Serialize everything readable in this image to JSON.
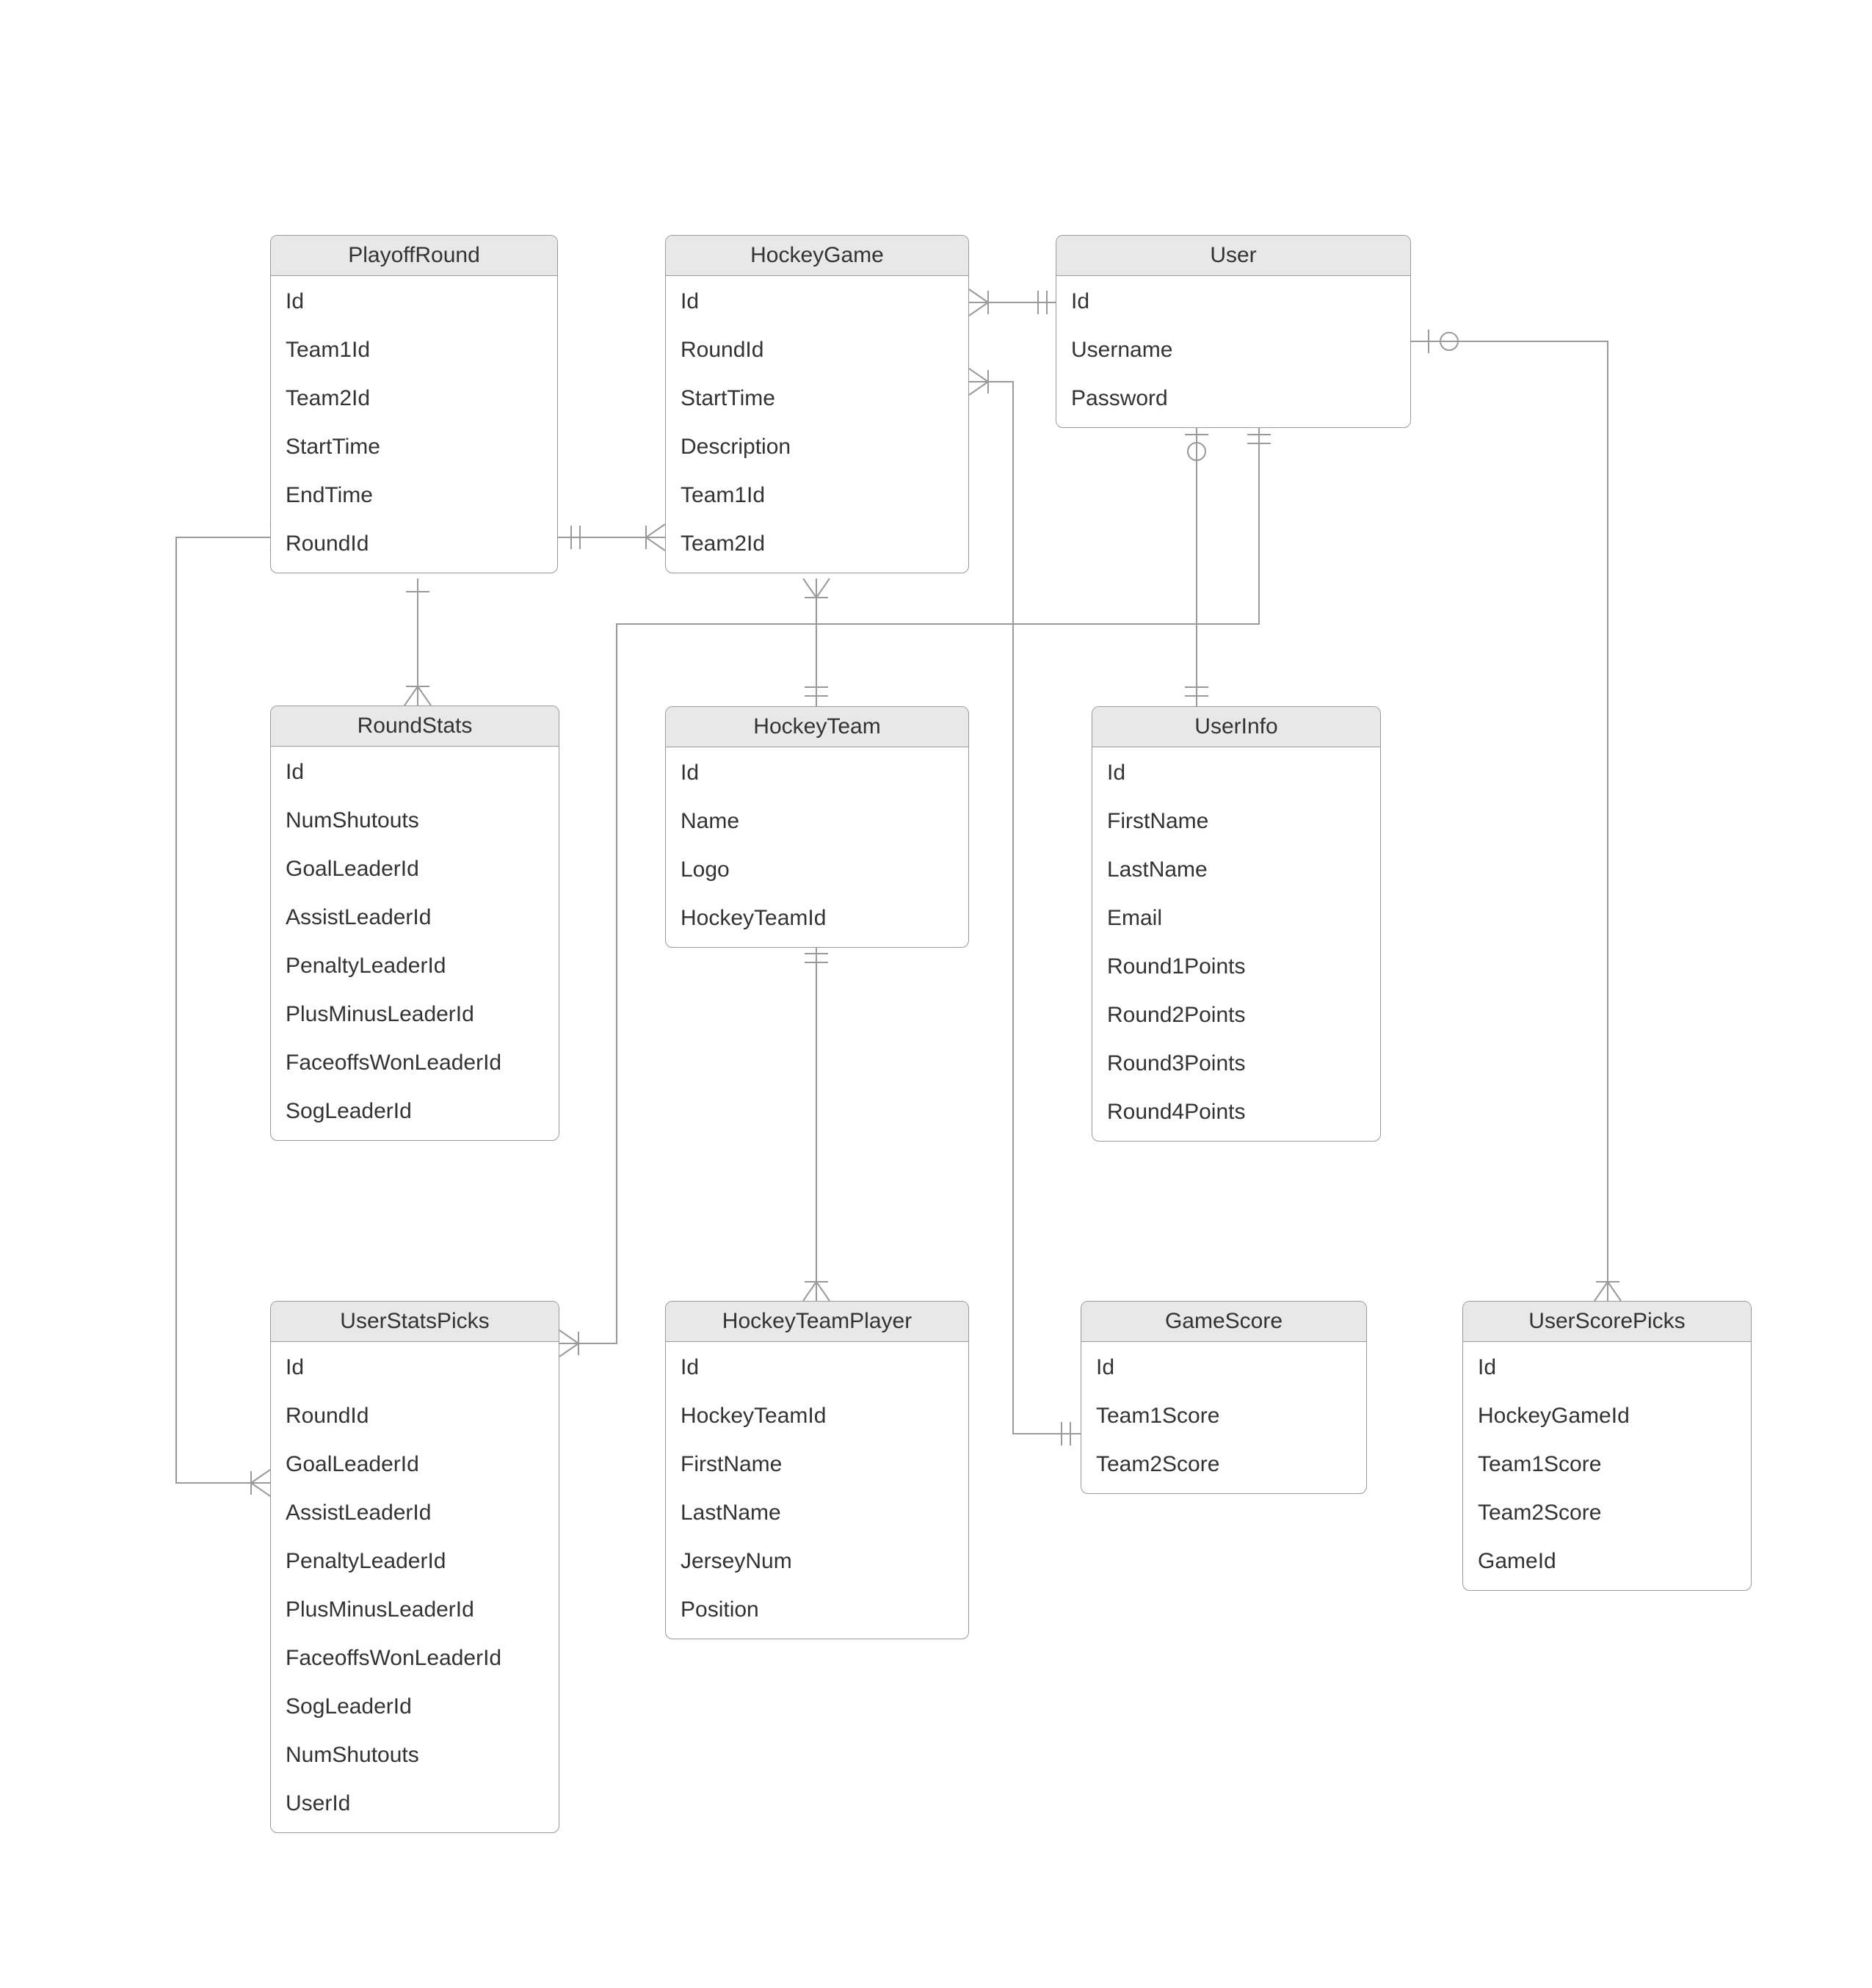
{
  "entities": {
    "playoffRound": {
      "title": "PlayoffRound",
      "attrs": [
        "Id",
        "Team1Id",
        "Team2Id",
        "StartTime",
        "EndTime",
        "RoundId"
      ]
    },
    "hockeyGame": {
      "title": "HockeyGame",
      "attrs": [
        "Id",
        "RoundId",
        "StartTime",
        "Description",
        "Team1Id",
        "Team2Id"
      ]
    },
    "user": {
      "title": "User",
      "attrs": [
        "Id",
        "Username",
        "Password"
      ]
    },
    "roundStats": {
      "title": "RoundStats",
      "attrs": [
        "Id",
        "NumShutouts",
        "GoalLeaderId",
        "AssistLeaderId",
        "PenaltyLeaderId",
        "PlusMinusLeaderId",
        "FaceoffsWonLeaderId",
        "SogLeaderId"
      ]
    },
    "hockeyTeam": {
      "title": "HockeyTeam",
      "attrs": [
        "Id",
        "Name",
        "Logo",
        "HockeyTeamId"
      ]
    },
    "userInfo": {
      "title": "UserInfo",
      "attrs": [
        "Id",
        "FirstName",
        "LastName",
        "Email",
        "Round1Points",
        "Round2Points",
        "Round3Points",
        "Round4Points"
      ]
    },
    "userStatsPicks": {
      "title": "UserStatsPicks",
      "attrs": [
        "Id",
        "RoundId",
        "GoalLeaderId",
        "AssistLeaderId",
        "PenaltyLeaderId",
        "PlusMinusLeaderId",
        "FaceoffsWonLeaderId",
        "SogLeaderId",
        "NumShutouts",
        "UserId"
      ]
    },
    "hockeyTeamPlayer": {
      "title": "HockeyTeamPlayer",
      "attrs": [
        "Id",
        "HockeyTeamId",
        "FirstName",
        "LastName",
        "JerseyNum",
        "Position"
      ]
    },
    "gameScore": {
      "title": "GameScore",
      "attrs": [
        "Id",
        "Team1Score",
        "Team2Score"
      ]
    },
    "userScorePicks": {
      "title": "UserScorePicks",
      "attrs": [
        "Id",
        "HockeyGameId",
        "Team1Score",
        "Team2Score",
        "GameId"
      ]
    }
  }
}
